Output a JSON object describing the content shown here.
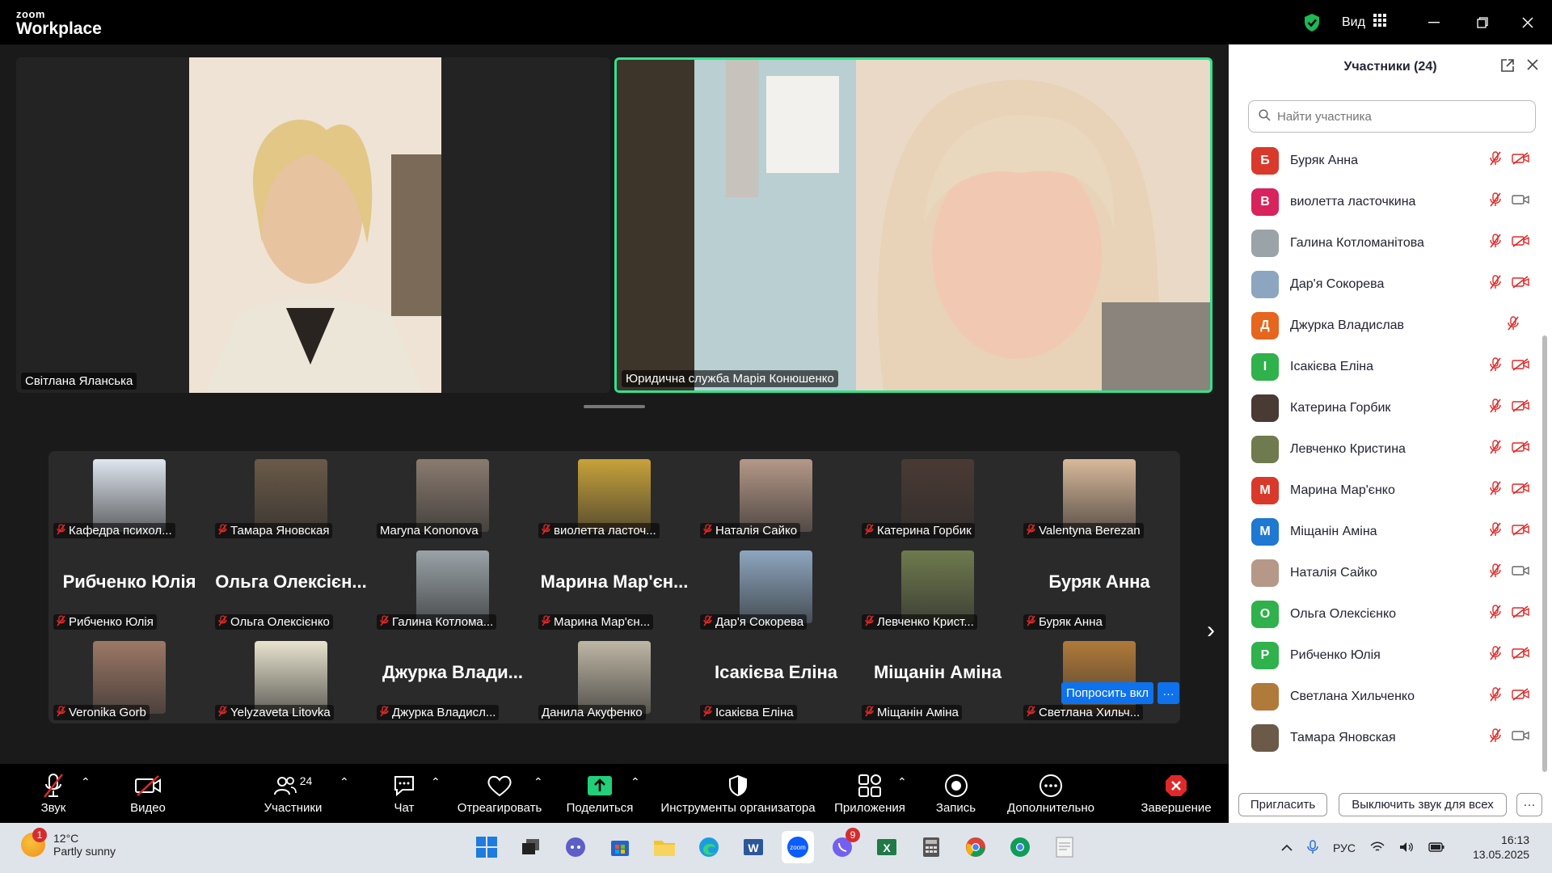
{
  "app": {
    "brand_small": "zoom",
    "brand_large": "Workplace"
  },
  "titlebar": {
    "view_label": "Вид"
  },
  "videos": [
    {
      "name": "Світлана Яланська"
    },
    {
      "name": "Юридична служба Марія Конюшенко"
    }
  ],
  "gallery": [
    {
      "label": "Кафедра психол...",
      "big": "",
      "muted": true,
      "thumb": "#dfe6ef"
    },
    {
      "label": "Тамара Яновская",
      "big": "",
      "muted": true,
      "thumb": "#6b5a48"
    },
    {
      "label": "Maryna Kononova",
      "big": "",
      "muted": false,
      "thumb": "#8a7b6f"
    },
    {
      "label": "виолетта ласточ...",
      "big": "",
      "muted": true,
      "thumb": "#c8a23a"
    },
    {
      "label": "Наталія  Сайко",
      "big": "",
      "muted": true,
      "thumb": "#b59888"
    },
    {
      "label": "Катерина Горбик",
      "big": "",
      "muted": true,
      "thumb": "#4a3a34"
    },
    {
      "label": "Valentyna Berezan",
      "big": "",
      "muted": true,
      "thumb": "#d9b99a"
    },
    {
      "label": "Рибченко Юлія",
      "big": "Рибченко Юлія",
      "muted": true,
      "thumb": ""
    },
    {
      "label": "Ольга Олексієнко",
      "big": "Ольга  Олексієн...",
      "muted": true,
      "thumb": ""
    },
    {
      "label": "Галина Котлома...",
      "big": "",
      "muted": true,
      "thumb": "#9aa3a8"
    },
    {
      "label": "Марина Мар'єн...",
      "big": "Марина  Мар'єн...",
      "muted": true,
      "thumb": ""
    },
    {
      "label": "Дар'я Сокорева",
      "big": "",
      "muted": true,
      "thumb": "#8da6bf"
    },
    {
      "label": "Левченко Крист...",
      "big": "",
      "muted": true,
      "thumb": "#6f7a4e"
    },
    {
      "label": "Буряк Анна",
      "big": "Буряк Анна",
      "muted": true,
      "thumb": ""
    },
    {
      "label": "Veronika Gorb",
      "big": "",
      "muted": true,
      "thumb": "#9d7866"
    },
    {
      "label": "Yelyzaveta Litovka",
      "big": "",
      "muted": true,
      "thumb": "#e9e4cf"
    },
    {
      "label": "Джурка Владисл...",
      "big": "Джурка  Влади...",
      "muted": true,
      "thumb": ""
    },
    {
      "label": "Данила Акуфенко",
      "big": "",
      "muted": false,
      "thumb": "#bfb7a6"
    },
    {
      "label": "Ісакієва Еліна",
      "big": "Ісакієва Еліна",
      "muted": true,
      "thumb": ""
    },
    {
      "label": "Міщанін Аміна",
      "big": "Міщанін Аміна",
      "muted": true,
      "thumb": ""
    },
    {
      "label": "Светлана Хильч...",
      "big": "",
      "muted": true,
      "thumb": "#b07a3a"
    }
  ],
  "gallery_actions": {
    "ask_label": "Попросить вкл",
    "more_label": "···"
  },
  "toolbar": {
    "audio": "Звук",
    "video": "Видео",
    "participants": "Участники",
    "participants_count": "24",
    "chat": "Чат",
    "react": "Отреагировать",
    "share": "Поделиться",
    "host_tools": "Инструменты организатора",
    "apps": "Приложения",
    "record": "Запись",
    "more": "Дополнительно",
    "end": "Завершение"
  },
  "panel": {
    "title": "Участники (24)",
    "search_placeholder": "Найти участника",
    "participants": [
      {
        "initial": "Б",
        "name": "Буряк Анна",
        "color": "#d8392b",
        "cam": "off",
        "mic": true
      },
      {
        "initial": "В",
        "name": "виолетта ласточкина",
        "color": "#d8235c",
        "cam": "on",
        "mic": true
      },
      {
        "initial": "",
        "name": "Галина Котломанітова",
        "color": "#9aa3a8",
        "cam": "off",
        "mic": true
      },
      {
        "initial": "",
        "name": "Дар'я Сокорева",
        "color": "#8da6bf",
        "cam": "off",
        "mic": true
      },
      {
        "initial": "Д",
        "name": "Джурка Владислав",
        "color": "#e5661c",
        "cam": "none",
        "mic": true
      },
      {
        "initial": "І",
        "name": "Ісакієва Еліна",
        "color": "#2fb14b",
        "cam": "off",
        "mic": true
      },
      {
        "initial": "",
        "name": "Катерина Горбик",
        "color": "#4a3a34",
        "cam": "off",
        "mic": true
      },
      {
        "initial": "",
        "name": "Левченко Кристина",
        "color": "#6f7a4e",
        "cam": "off",
        "mic": true
      },
      {
        "initial": "М",
        "name": "Марина Мар'єнко",
        "color": "#d8392b",
        "cam": "off",
        "mic": true
      },
      {
        "initial": "М",
        "name": "Міщанін Аміна",
        "color": "#1f78d1",
        "cam": "off",
        "mic": true
      },
      {
        "initial": "",
        "name": "Наталія  Сайко",
        "color": "#b59888",
        "cam": "on",
        "mic": true
      },
      {
        "initial": "О",
        "name": "Ольга Олексієнко",
        "color": "#2fb14b",
        "cam": "off",
        "mic": true
      },
      {
        "initial": "Р",
        "name": "Рибченко Юлія",
        "color": "#2fb14b",
        "cam": "off",
        "mic": true
      },
      {
        "initial": "",
        "name": "Светлана Хильченко",
        "color": "#b07a3a",
        "cam": "off",
        "mic": true
      },
      {
        "initial": "",
        "name": "Тамара Яновская",
        "color": "#6b5a48",
        "cam": "on",
        "mic": true
      }
    ],
    "invite": "Пригласить",
    "mute_all": "Выключить звук для всех",
    "more": "···"
  },
  "taskbar": {
    "temp": "12°C",
    "weather": "Partly sunny",
    "weather_badge": "1",
    "viber_badge": "9",
    "lang": "РУС",
    "time": "16:13",
    "date": "13.05.2025"
  }
}
